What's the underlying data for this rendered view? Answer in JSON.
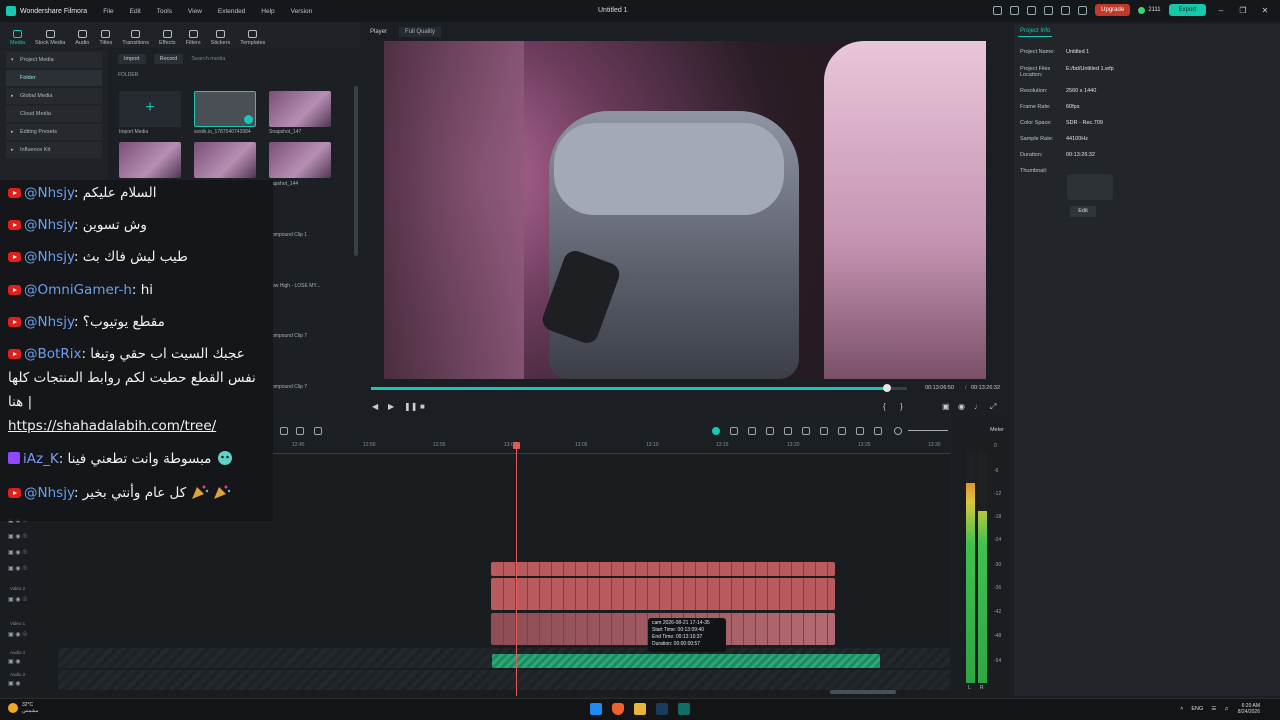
{
  "titlebar": {
    "app_name": "Wondershare Filmora",
    "menu": [
      "File",
      "Edit",
      "Tools",
      "View",
      "Extended",
      "Help",
      "Version"
    ],
    "document_title": "Untitled 1",
    "upgrade_label": "Upgrade",
    "credits": "2111",
    "export_label": "Export"
  },
  "media_tabs": [
    "Media",
    "Stock Media",
    "Audio",
    "Titles",
    "Transitions",
    "Effects",
    "Filters",
    "Stickers",
    "Templates"
  ],
  "left_nav": {
    "items": [
      "Project Media",
      "Folder",
      "Global Media",
      "Cloud Media",
      "Editing Presets",
      "Influence Kit"
    ]
  },
  "media_panel": {
    "import_label": "Import",
    "record_label": "Record",
    "search_placeholder": "Search media",
    "folder_label": "FOLDER",
    "import_media_label": "Import Media",
    "items": [
      {
        "label": "ssstik.io_1787540743984",
        "duration": "00:00:27"
      },
      {
        "label": "Snapshot_147"
      },
      {
        "label": "apshot_144"
      },
      {
        "label": "ompound Clip 1"
      },
      {
        "label": "ow High - LOSE MY...",
        "duration": "00:02:20"
      },
      {
        "label": "ompound Clip 7"
      },
      {
        "label": "ompound Clip 7"
      },
      {
        "label": "",
        "duration": "00:02:06"
      }
    ]
  },
  "player": {
    "label": "Player",
    "quality": "Full Quality",
    "current_time": "00:13:06:50",
    "total_time": "00:13:26:32",
    "progress_fraction": 0.963
  },
  "project_info": {
    "tab": "Project Info",
    "rows": [
      {
        "key": "Project Name:",
        "value": "Untitled 1"
      },
      {
        "key": "Project Files Location:",
        "value": "E:/bd/Untitled 1.wfp"
      },
      {
        "key": "Resolution:",
        "value": "2560 x 1440"
      },
      {
        "key": "Frame Rate:",
        "value": "60fps"
      },
      {
        "key": "Color Space:",
        "value": "SDR - Rec.709"
      },
      {
        "key": "Sample Rate:",
        "value": "44100Hz"
      },
      {
        "key": "Duration:",
        "value": "00:13:26:32"
      },
      {
        "key": "Thumbnail:",
        "value": ""
      }
    ],
    "edit_label": "Edit"
  },
  "timeline": {
    "ruler_ticks": [
      "12:45",
      "12:50",
      "12:55",
      "13:00",
      "13:05",
      "13:10",
      "13:15",
      "13:20",
      "13:25",
      "13:30"
    ],
    "track_labels": [
      "Video 2",
      "Video 1",
      "Audio 1",
      "Audio 2"
    ],
    "tooltip": {
      "name": "cam 2026-08-21 17-14-35",
      "start": "Start Time: 00:13:09:40",
      "end": "End Time: 00:13:10:37",
      "duration": "Duration: 00:00:00:57"
    }
  },
  "meter": {
    "label": "Meter",
    "db_labels": [
      "0",
      "-6",
      "-12",
      "-18",
      "-24",
      "-30",
      "-36",
      "-42",
      "-48",
      "-54"
    ],
    "left_label": "L",
    "right_label": "R"
  },
  "chat": {
    "messages": [
      {
        "platform": "youtube",
        "user": "@Nhsjy",
        "text": "السلام عليكم"
      },
      {
        "platform": "youtube",
        "user": "@Nhsjy",
        "text": "وش تسوين"
      },
      {
        "platform": "youtube",
        "user": "@Nhsjy",
        "text": "طيب ليش فاك بث"
      },
      {
        "platform": "youtube",
        "user": "@OmniGamer-h",
        "text": "hi"
      },
      {
        "platform": "youtube",
        "user": "@Nhsjy",
        "text": "مقطع يوتيوب؟"
      },
      {
        "platform": "youtube",
        "user": "@BotRix",
        "text": "عجبك السيت اب حقي وتبغا",
        "line2": "نفس القطع حطيت لكم روابط المنتجات كلها",
        "line3": "هنا |",
        "link": "https://shahadalabih.com/tree/"
      },
      {
        "platform": "twitch",
        "user": "iAz_K",
        "text": "مبسوطة وانت تطعني فينا"
      },
      {
        "platform": "youtube",
        "user": "@Nhsjy",
        "text": "كل عام وأنتي بخير"
      }
    ]
  },
  "taskbar": {
    "temperature": "32°C",
    "weather": "مشمس",
    "language": "ENG",
    "time": "6:20 AM",
    "date": "8/24/2026"
  },
  "colors": {
    "accent": "#19c8b4",
    "playhead": "#e05a5a",
    "video_clip": "#b85a5e",
    "audio_clip": "#2aa876",
    "youtube": "#e0201f",
    "twitch": "#9146ff",
    "username": "#6aa0ee"
  }
}
